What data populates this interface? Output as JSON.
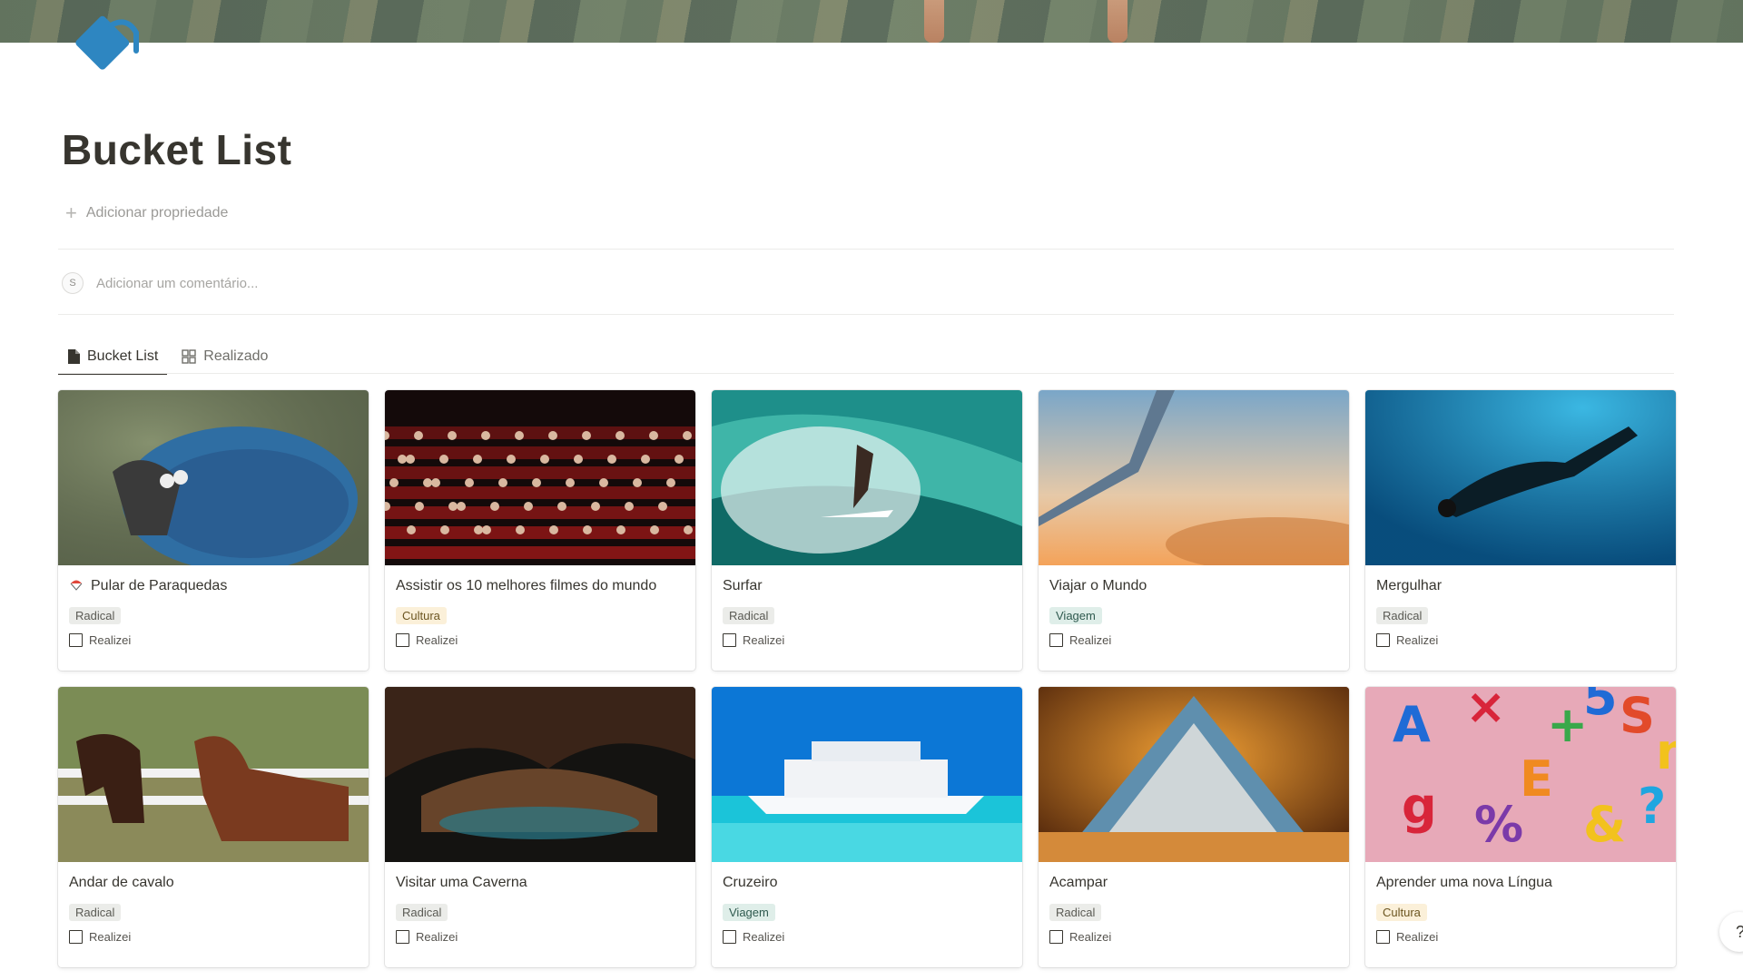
{
  "page": {
    "title": "Bucket List",
    "add_property": "Adicionar propriedade",
    "comment_placeholder": "Adicionar um comentário...",
    "avatar_initial": "S"
  },
  "tabs": [
    {
      "label": "Bucket List",
      "icon": "document-icon",
      "active": true
    },
    {
      "label": "Realizado",
      "icon": "gallery-icon",
      "active": false
    }
  ],
  "colors": {
    "Radical": {
      "bg": "#ebece9",
      "fg": "#5a5a54"
    },
    "Cultura": {
      "bg": "#fbf0d9",
      "fg": "#6b5520"
    },
    "Viagem": {
      "bg": "#dfeee9",
      "fg": "#2f5a4f"
    }
  },
  "cards": [
    {
      "title": "Pular de Paraquedas",
      "icon": "parachute-icon",
      "tag": "Radical",
      "check_label": "Realizei",
      "checked": false,
      "image": "paragliding"
    },
    {
      "title": "Assistir os 10 melhores filmes do mundo",
      "tag": "Cultura",
      "check_label": "Realizei",
      "checked": false,
      "image": "cinema"
    },
    {
      "title": "Surfar",
      "tag": "Radical",
      "check_label": "Realizei",
      "checked": false,
      "image": "surf"
    },
    {
      "title": "Viajar o Mundo",
      "tag": "Viagem",
      "check_label": "Realizei",
      "checked": false,
      "image": "airplane"
    },
    {
      "title": "Mergulhar",
      "tag": "Radical",
      "check_label": "Realizei",
      "checked": false,
      "image": "diving"
    },
    {
      "title": "Andar de cavalo",
      "tag": "Radical",
      "check_label": "Realizei",
      "checked": false,
      "image": "horses"
    },
    {
      "title": "Visitar uma Caverna",
      "tag": "Radical",
      "check_label": "Realizei",
      "checked": false,
      "image": "cave"
    },
    {
      "title": "Cruzeiro",
      "tag": "Viagem",
      "check_label": "Realizei",
      "checked": false,
      "image": "cruise"
    },
    {
      "title": "Acampar",
      "tag": "Radical",
      "check_label": "Realizei",
      "checked": false,
      "image": "tent"
    },
    {
      "title": "Aprender uma nova Língua",
      "tag": "Cultura",
      "check_label": "Realizei",
      "checked": false,
      "image": "letters"
    }
  ],
  "help_label": "?"
}
